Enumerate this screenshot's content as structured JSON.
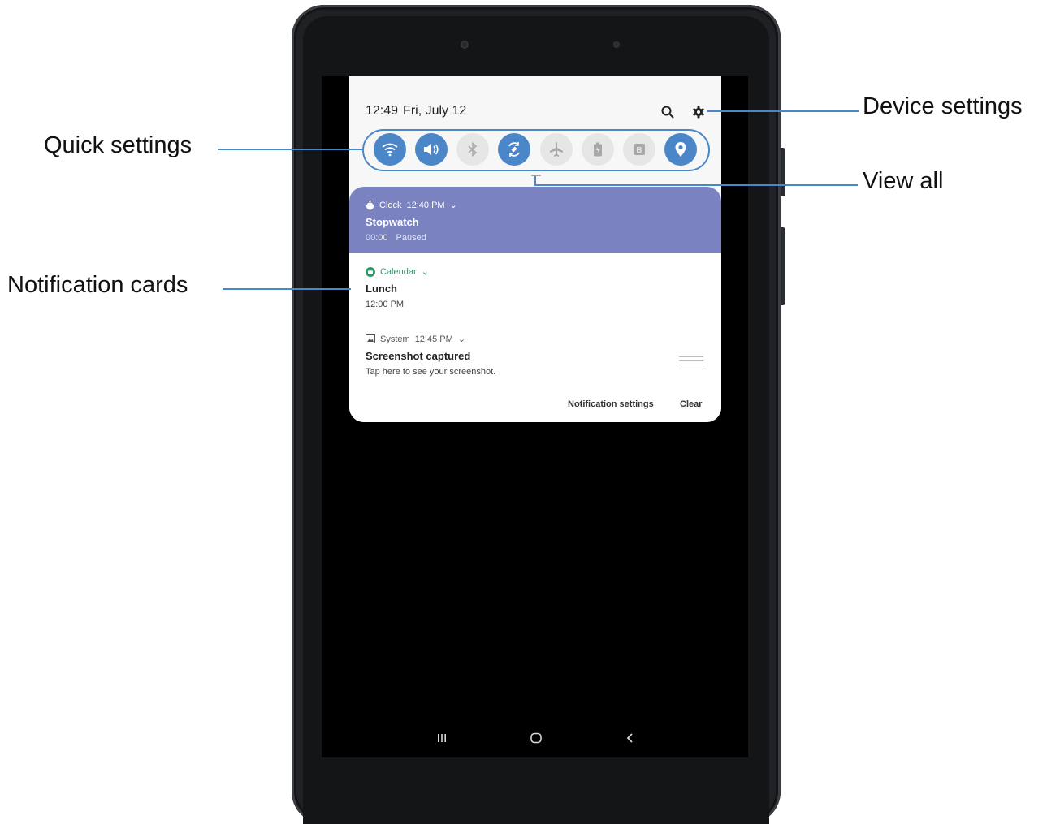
{
  "callouts": {
    "quick_settings": "Quick settings",
    "notification_cards": "Notification cards",
    "device_settings": "Device settings",
    "view_all": "View all"
  },
  "status": {
    "time": "12:49",
    "date": "Fri, July 12"
  },
  "top_icons": [
    "search-icon",
    "gear-icon"
  ],
  "quick_settings": [
    {
      "name": "wifi",
      "state": "on"
    },
    {
      "name": "sound",
      "state": "on"
    },
    {
      "name": "bluetooth",
      "state": "off"
    },
    {
      "name": "auto-rotate",
      "state": "on"
    },
    {
      "name": "airplane-mode",
      "state": "off"
    },
    {
      "name": "power-saving",
      "state": "off"
    },
    {
      "name": "blue-light-filter",
      "state": "off"
    },
    {
      "name": "location",
      "state": "on"
    }
  ],
  "notifications": {
    "clock": {
      "app": "Clock",
      "time": "12:40 PM",
      "title": "Stopwatch",
      "value": "00:00",
      "status": "Paused"
    },
    "calendar": {
      "app": "Calendar",
      "title": "Lunch",
      "time": "12:00 PM"
    },
    "system": {
      "app": "System",
      "time": "12:45 PM",
      "title": "Screenshot captured",
      "text": "Tap here to see your screenshot."
    }
  },
  "footer": {
    "settings": "Notification settings",
    "clear": "Clear"
  },
  "colors": {
    "accent": "#4a86c8",
    "clock_card": "#7a82c0",
    "calendar_green": "#2e9a6b"
  },
  "navbar": [
    "recents-icon",
    "home-icon",
    "back-icon"
  ]
}
